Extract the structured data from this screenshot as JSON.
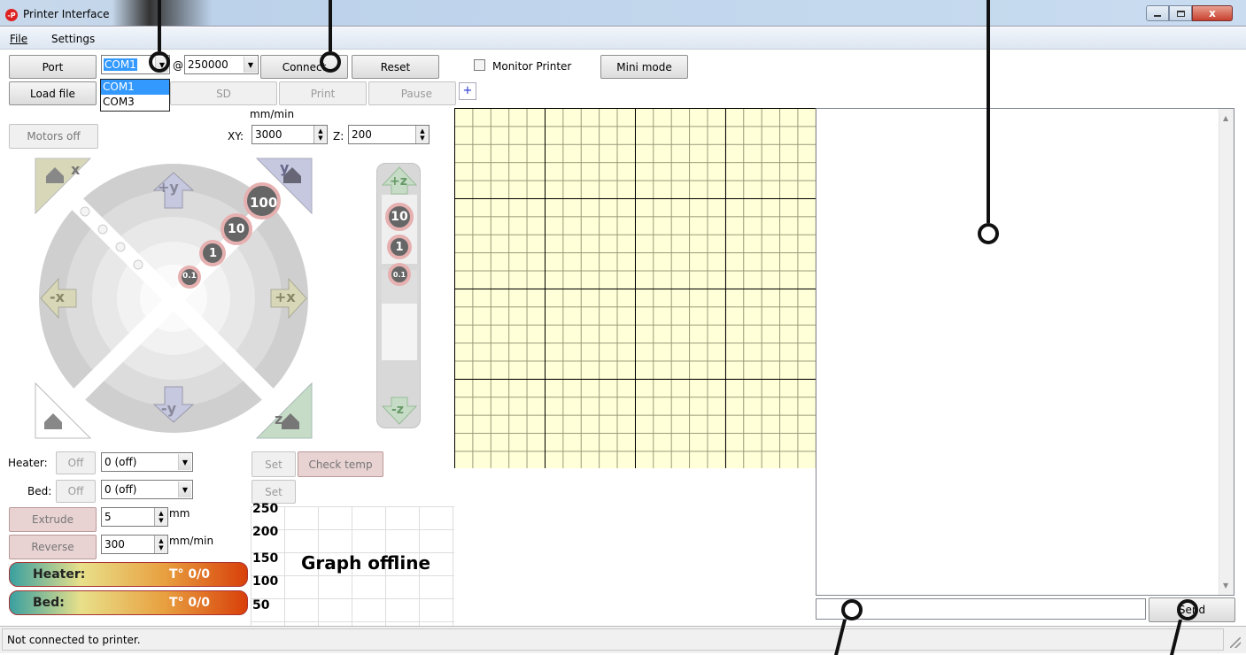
{
  "window": {
    "title": "Printer Interface",
    "icon": "printrun-logo-icon"
  },
  "menu": {
    "file": "File",
    "settings": "Settings"
  },
  "toolbar": {
    "port_label": "Port",
    "port_value": "COM1",
    "port_options": [
      "COM1",
      "COM3"
    ],
    "at_sign": "@",
    "baud_value": "250000",
    "connect_label": "Connect",
    "reset_label": "Reset",
    "monitor_label": "Monitor Printer",
    "mini_mode_label": "Mini mode",
    "load_file_label": "Load file",
    "sd_label": "SD",
    "print_label": "Print",
    "pause_label": "Pause",
    "plus_label": "+"
  },
  "controls": {
    "motors_off_label": "Motors off",
    "feed_unit": "mm/min",
    "xy_label": "XY:",
    "xy_value": "3000",
    "z_label": "Z:",
    "z_value": "200"
  },
  "jog": {
    "home_x": "x",
    "home_y": "y",
    "home_z": "z",
    "plus_y": "+y",
    "minus_y": "-y",
    "plus_x": "+x",
    "minus_x": "-x",
    "plus_z": "+z",
    "minus_z": "-z",
    "steps": [
      "100",
      "10",
      "1",
      "0.1"
    ],
    "z_steps": [
      "10",
      "1",
      "0.1"
    ]
  },
  "temperature": {
    "heater_label": "Heater:",
    "heater_off": "Off",
    "heater_value": "0 (off)",
    "bed_label": "Bed:",
    "bed_off": "Off",
    "bed_value": "0 (off)",
    "set_label": "Set",
    "check_temp_label": "Check temp",
    "extrude_label": "Extrude",
    "extrude_value": "5",
    "extrude_unit": "mm",
    "reverse_label": "Reverse",
    "reverse_value": "300",
    "reverse_unit": "mm/min",
    "heater_gauge_label": "Heater:",
    "heater_gauge_value": "T° 0/0",
    "bed_gauge_label": "Bed:",
    "bed_gauge_value": "T° 0/0"
  },
  "graph": {
    "offline_text": "Graph offline",
    "ticks": [
      "250",
      "200",
      "150",
      "100",
      "50"
    ]
  },
  "console": {
    "send_label": "Send",
    "command_value": ""
  },
  "status": {
    "text": "Not connected to printer."
  }
}
